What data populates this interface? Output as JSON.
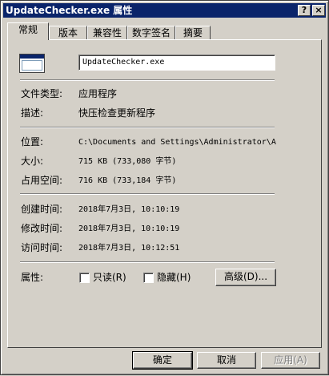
{
  "window": {
    "title": "UpdateChecker.exe 属性",
    "help_button": "?",
    "close_button": "×"
  },
  "tabs": [
    {
      "label": "常规",
      "active": true
    },
    {
      "label": "版本",
      "active": false
    },
    {
      "label": "兼容性",
      "active": false
    },
    {
      "label": "数字签名",
      "active": false
    },
    {
      "label": "摘要",
      "active": false
    }
  ],
  "general": {
    "file_name": "UpdateChecker.exe",
    "icon": "exe-window-icon",
    "type": {
      "label": "文件类型:",
      "value": "应用程序"
    },
    "description": {
      "label": "描述:",
      "value": "快压检查更新程序"
    },
    "location": {
      "label": "位置:",
      "value": "C:\\Documents and Settings\\Administrator\\A"
    },
    "size": {
      "label": "大小:",
      "value": "715 KB (733,080 字节)"
    },
    "size_on_disk": {
      "label": "占用空间:",
      "value": "716 KB (733,184 字节)"
    },
    "created": {
      "label": "创建时间:",
      "value": "2018年7月3日, 10:10:19"
    },
    "modified": {
      "label": "修改时间:",
      "value": "2018年7月3日, 10:10:19"
    },
    "accessed": {
      "label": "访问时间:",
      "value": "2018年7月3日, 10:12:51"
    },
    "attributes": {
      "label": "属性:",
      "readonly": {
        "label": "只读(R)",
        "checked": false
      },
      "hidden": {
        "label": "隐藏(H)",
        "checked": false
      },
      "advanced_button": "高级(D)..."
    }
  },
  "buttons": {
    "ok": "确定",
    "cancel": "取消",
    "apply": "应用(A)"
  }
}
